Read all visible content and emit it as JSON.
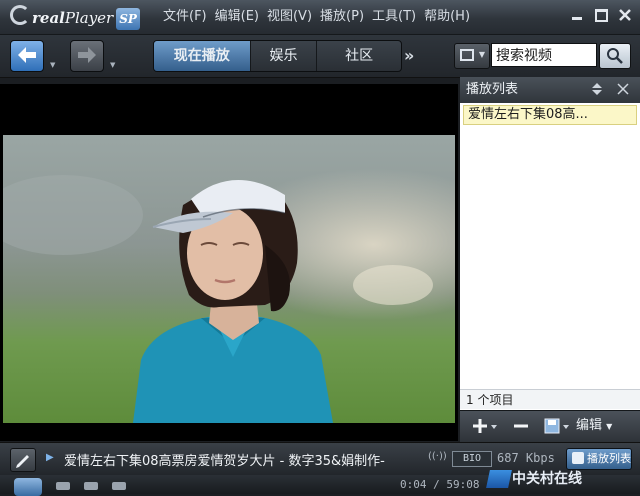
{
  "app": {
    "logo_text": "real",
    "logo_player": "Player",
    "logo_sp": "SP"
  },
  "menu": [
    "文件(F)",
    "编辑(E)",
    "视图(V)",
    "播放(P)",
    "工具(T)",
    "帮助(H)"
  ],
  "toolbar": {
    "tabs": [
      "现在播放",
      "娱乐",
      "社区"
    ],
    "more": "»",
    "search_value": "搜索视频"
  },
  "playlist": {
    "title": "播放列表",
    "items": [
      "爱情左右下集08高..."
    ],
    "count": "1 个项目",
    "save_label": "编辑"
  },
  "status": {
    "now_playing": "爱情左右下集08高票房爱情贺岁大片 - 数字35&娟制作-",
    "signal": "((·))",
    "bitrate_box": "BIO",
    "bitrate": "687 Kbps",
    "playlist_toggle": "播放列表"
  },
  "transport": {
    "time": "0:04 / 59:08"
  },
  "watermark": "中关村在线",
  "colors": {
    "accent": "#3d74b2",
    "highlight_item": "#fbf7c8"
  }
}
